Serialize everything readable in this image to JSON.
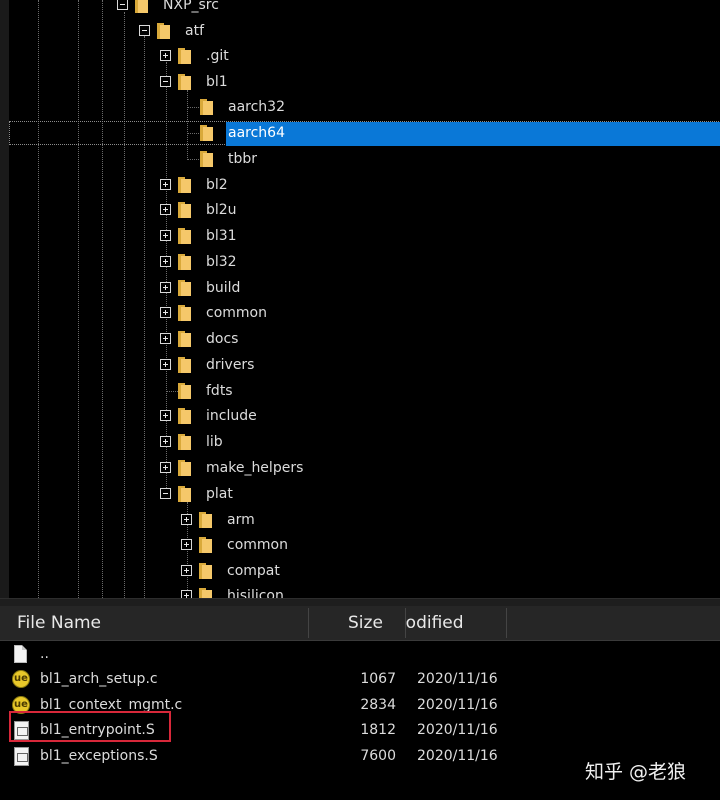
{
  "tree": {
    "nodes": [
      {
        "label": "NXP_src",
        "expander": "minus"
      },
      {
        "label": "atf",
        "expander": "minus"
      },
      {
        "label": ".git",
        "expander": "plus"
      },
      {
        "label": "bl1",
        "expander": "minus"
      },
      {
        "label": "aarch32",
        "expander": "none"
      },
      {
        "label": "aarch64",
        "expander": "none",
        "selected": true
      },
      {
        "label": "tbbr",
        "expander": "none"
      },
      {
        "label": "bl2",
        "expander": "plus"
      },
      {
        "label": "bl2u",
        "expander": "plus"
      },
      {
        "label": "bl31",
        "expander": "plus"
      },
      {
        "label": "bl32",
        "expander": "plus"
      },
      {
        "label": "build",
        "expander": "plus"
      },
      {
        "label": "common",
        "expander": "plus"
      },
      {
        "label": "docs",
        "expander": "plus"
      },
      {
        "label": "drivers",
        "expander": "plus"
      },
      {
        "label": "fdts",
        "expander": "none"
      },
      {
        "label": "include",
        "expander": "plus"
      },
      {
        "label": "lib",
        "expander": "plus"
      },
      {
        "label": "make_helpers",
        "expander": "plus"
      },
      {
        "label": "plat",
        "expander": "minus"
      },
      {
        "label": "arm",
        "expander": "plus"
      },
      {
        "label": "common",
        "expander": "plus"
      },
      {
        "label": "compat",
        "expander": "plus"
      },
      {
        "label": "hisilicon",
        "expander": "plus"
      }
    ],
    "selection_color": "#0a78d7",
    "folder_icon": "folder-icon"
  },
  "file_list": {
    "columns": {
      "name": "File Name",
      "size": "Size",
      "modified": "Modified"
    },
    "rows": [
      {
        "name": "..",
        "size": "",
        "modified": "",
        "icon": "parent-dir-icon"
      },
      {
        "name": "bl1_arch_setup.c",
        "size": "1067",
        "modified": "2020/11/16",
        "icon": "c-source-icon"
      },
      {
        "name": "bl1_context_mgmt.c",
        "size": "2834",
        "modified": "2020/11/16",
        "icon": "c-source-icon"
      },
      {
        "name": "bl1_entrypoint.S",
        "size": "1812",
        "modified": "2020/11/16",
        "icon": "asm-file-icon",
        "highlighted": true
      },
      {
        "name": "bl1_exceptions.S",
        "size": "7600",
        "modified": "2020/11/16",
        "icon": "asm-file-icon"
      }
    ],
    "highlight_color": "#d8283a"
  },
  "watermark": "知乎 @老狼"
}
